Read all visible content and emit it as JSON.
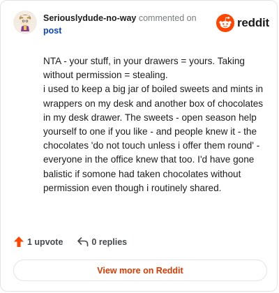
{
  "comment": {
    "author": "Seriouslydude-no-way",
    "action_text": "commented on",
    "post_link": "post",
    "body": "NTA - your stuff, in your drawers = yours. Taking without permission = stealing.\ni used to keep a big jar of boiled sweets and mints in wrappers on my desk and another box of chocolates in my desk drawer. The sweets - open season help yourself to one if you like - and people knew it - the chocolates 'do not touch unless i offer them round' -everyone in the office knew that too. I'd have gone balistic if somone had taken chocolates without permission even though i routinely shared."
  },
  "brand": {
    "name": "reddit",
    "color": "#ff4500"
  },
  "actions": {
    "upvotes": "1 upvote",
    "replies": "0 replies"
  },
  "footer": {
    "view_more": "View more on Reddit"
  },
  "colors": {
    "link": "#0a45c4",
    "accent": "#d93a00",
    "upvote": "#ff4500"
  },
  "icons": {
    "avatar": "avatar-icon",
    "logo": "reddit-snoo-icon",
    "upvote": "upvote-arrow-icon",
    "reply": "reply-arrow-icon"
  }
}
